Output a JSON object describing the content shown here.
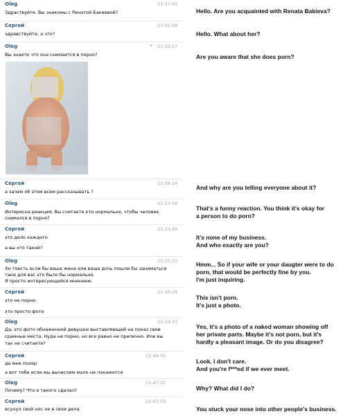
{
  "messages": [
    {
      "name": "Oleg",
      "time": "21:37:00",
      "lines": [
        "Здраствуйте. Вы знакомы с Ренатой Бакиевой?"
      ]
    },
    {
      "name": "Сергей",
      "time": "21:41:58",
      "lines": [
        "здравствуйте, а что?"
      ]
    },
    {
      "name": "Oleg",
      "time": "21:43:27",
      "lines": [
        "Вы знаете что она снимается в порно?"
      ]
    },
    {
      "name": "Сергей",
      "time": "22:09:24",
      "lines": [
        "а зачем об этом всем рассказывать ?"
      ]
    },
    {
      "name": "Oleg",
      "time": "22:23:09",
      "lines": [
        "Интересна реакция. Вы считаете кто нормально, чтобы человек",
        "снимался в порно?"
      ]
    },
    {
      "name": "Сергей",
      "time": "22:23:49",
      "lines": [
        "это дело каждого",
        "а вы кто такой?"
      ]
    },
    {
      "name": "Oleg",
      "time": "22:25:33",
      "lines": [
        "Хн тоесть если бы ваша жена или ваша дочь пошли бы заниматься",
        "таки для вас это было бы нормально.",
        "Я просто интересующийся мнением."
      ]
    },
    {
      "name": "Сергей",
      "time": "22:30:28",
      "lines": [
        "это не порно",
        "это просто фото"
      ]
    },
    {
      "name": "Oleg",
      "time": "22:34:33",
      "lines": [
        "Да, это фото обнаженной девушки выставляющей на показ свои",
        "срамные места. Нуда не порно, но все равно не прилично. Или вы",
        "так не считаете?"
      ]
    },
    {
      "name": "Сергей",
      "time": "22:44:50",
      "lines": [
        "да мне похер",
        "а вот тебе        если мы вычислим мало не покажется"
      ]
    },
    {
      "name": "Oleg",
      "time": "22:47:31",
      "lines": [
        "Почему? Что я такого сделал?"
      ]
    },
    {
      "name": "Сергей",
      "time": "22:47:50",
      "lines": [
        "всунул свой нос не в свои дела"
      ]
    }
  ],
  "translations": [
    {
      "lines": [
        "Hello. Are you acquainted with Renata Bakieva?"
      ]
    },
    {
      "lines": [
        "Hello. What about her?"
      ]
    },
    {
      "lines": [
        "Are you aware that she does porn?"
      ]
    },
    {
      "lines": [
        "And why are you telling everyone about it?"
      ]
    },
    {
      "lines": [
        "That's a funny reaction. You think it's okay for",
        "a person to do porn?"
      ]
    },
    {
      "lines": [
        "It's none of my business.",
        "And who exactly are you?"
      ]
    },
    {
      "lines": [
        "Hmm... So if your wife or your daugter were to do",
        "porn, that would be perfectly fine by you.",
        "I'm just inquiring."
      ]
    },
    {
      "lines": [
        "This isn't porn.",
        "It's just a photo."
      ]
    },
    {
      "lines": [
        "Yes, it's a photo of a naked woman showing off",
        "her private parts. Maybe it's not porn, but it's",
        "hardly a pleasant image. Or do you disagree?"
      ]
    },
    {
      "lines": [
        "Look. I don't care.",
        "And you're f***ed if we ever meet."
      ]
    },
    {
      "lines": [
        "Why? What did I do?"
      ]
    },
    {
      "lines": [
        "You stuck your nose into other people's business."
      ]
    }
  ],
  "colors": {
    "name": "#2b587a",
    "time": "#9aa3ac",
    "divider": "#e3e7ec"
  },
  "icons": {
    "favorite": "star-icon"
  }
}
